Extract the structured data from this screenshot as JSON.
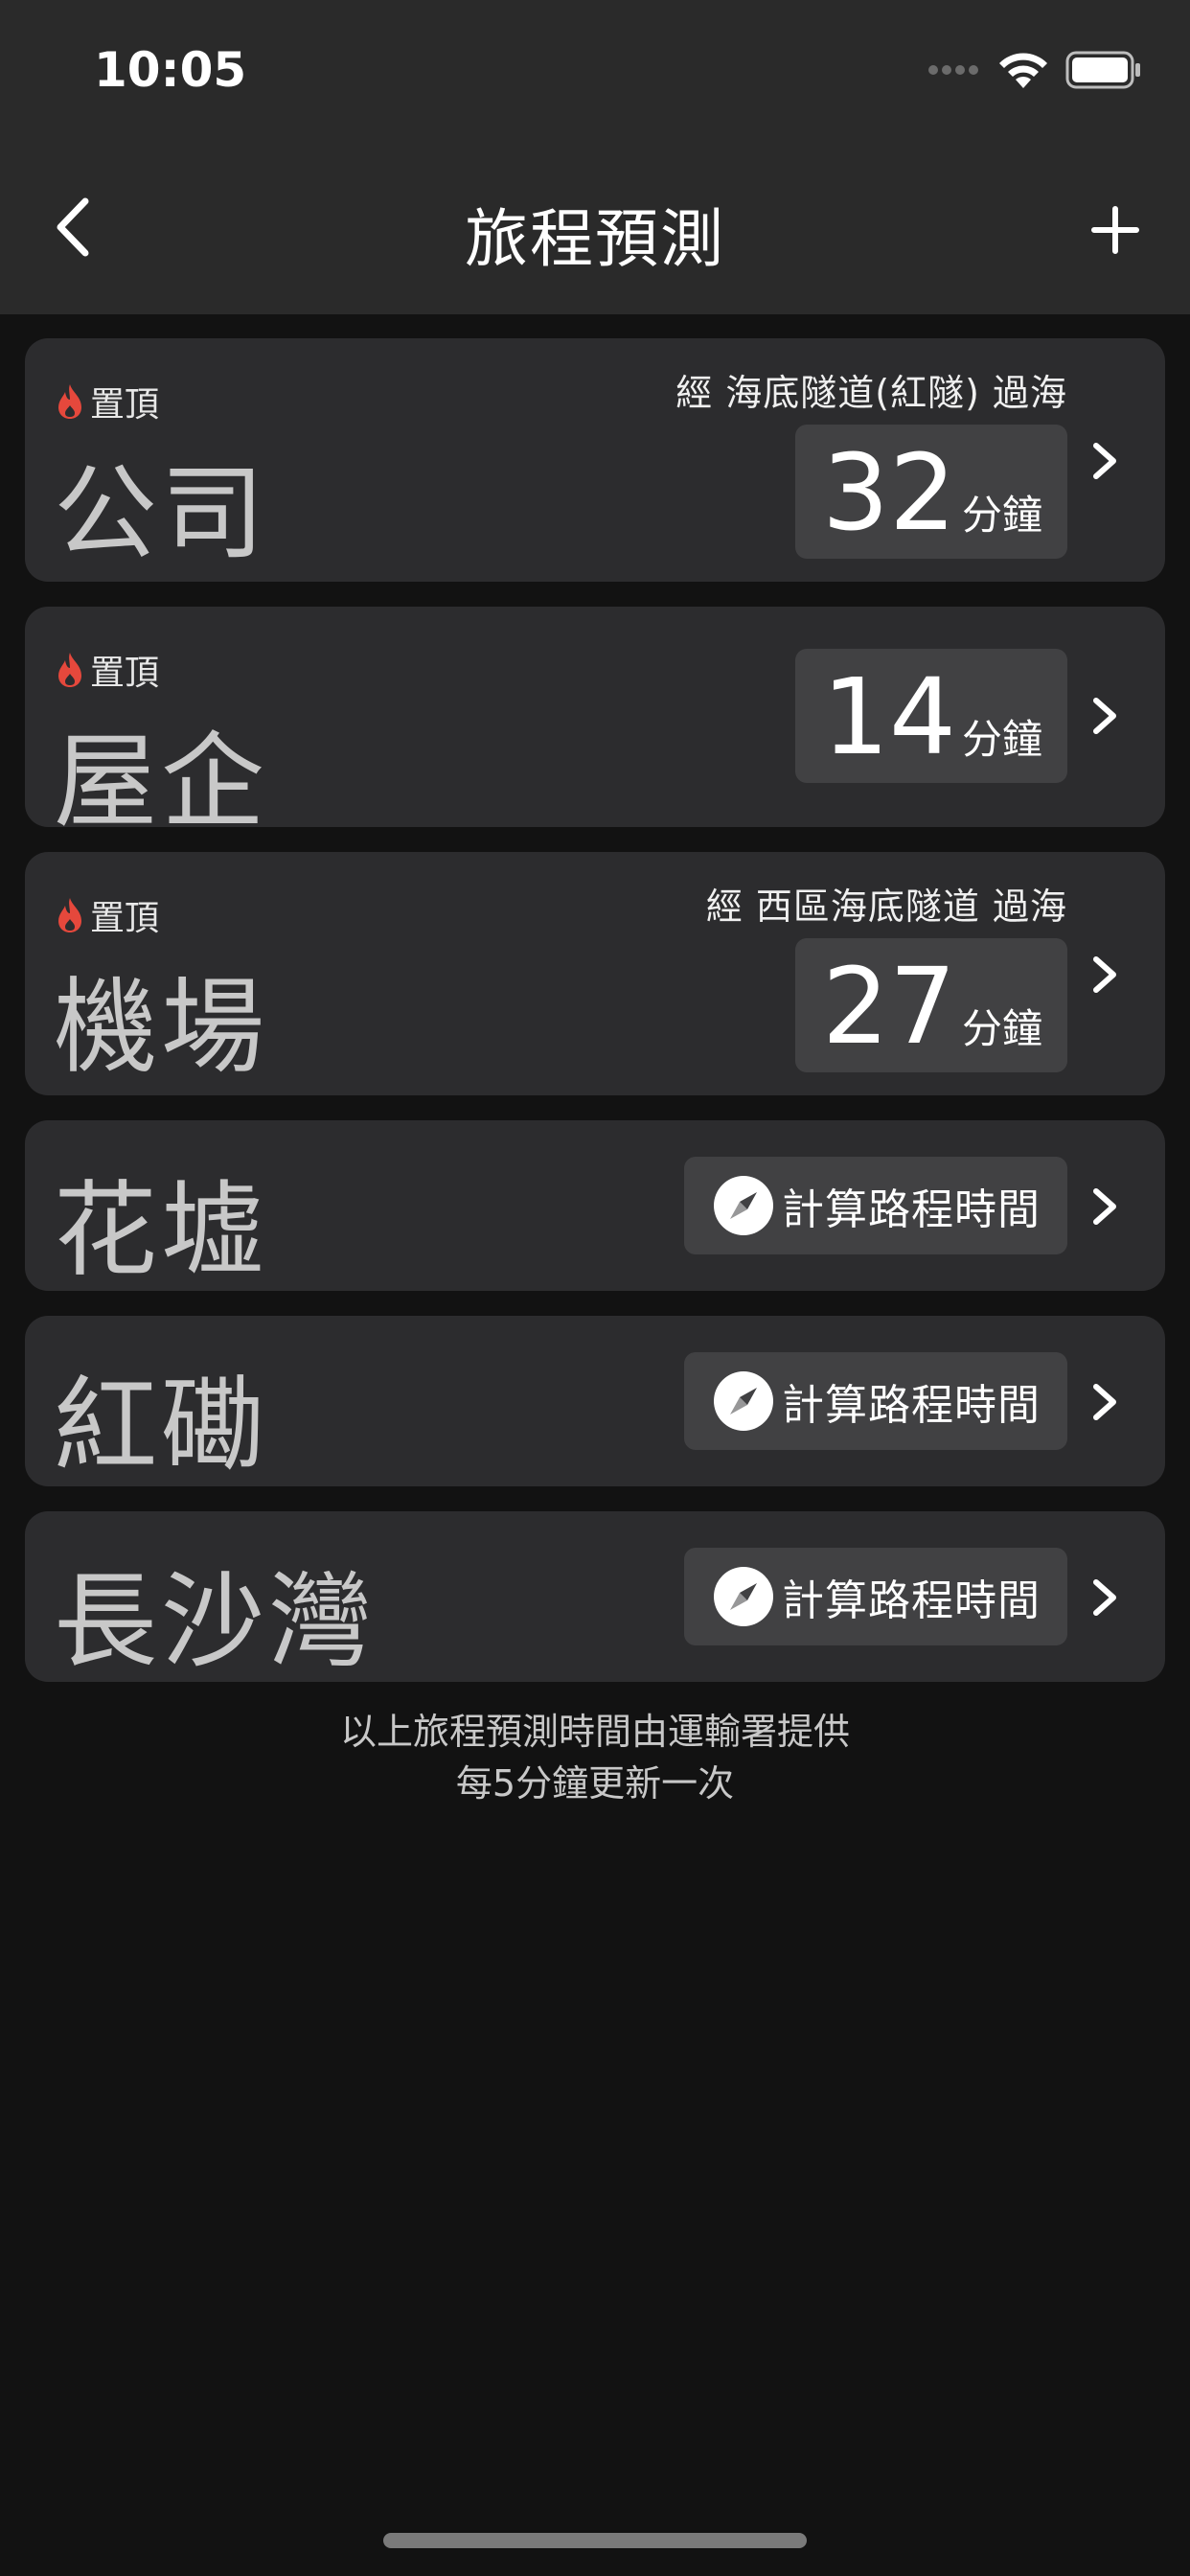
{
  "status_bar": {
    "time": "10:05"
  },
  "nav": {
    "title": "旅程預測"
  },
  "pin_label": "置頂",
  "eta_unit": "分鐘",
  "calc_label": "計算路程時間",
  "destinations": [
    {
      "name": "公司",
      "pinned": true,
      "route": "經 海底隧道(紅隧) 過海",
      "eta": "32"
    },
    {
      "name": "屋企",
      "pinned": true,
      "route": "",
      "eta": "14"
    },
    {
      "name": "機場",
      "pinned": true,
      "route": "經 西區海底隧道 過海",
      "eta": "27"
    },
    {
      "name": "花墟",
      "pinned": false,
      "route": "",
      "eta": ""
    },
    {
      "name": "紅磡",
      "pinned": false,
      "route": "",
      "eta": ""
    },
    {
      "name": "長沙灣",
      "pinned": false,
      "route": "",
      "eta": ""
    }
  ],
  "footer": {
    "line1": "以上旅程預測時間由運輸署提供",
    "line2": "每5分鐘更新一次"
  },
  "colors": {
    "background": "#121212",
    "bar": "#2a2a2a",
    "card": "#2c2c2e",
    "pill": "#414143",
    "flame": "#e5483c"
  }
}
